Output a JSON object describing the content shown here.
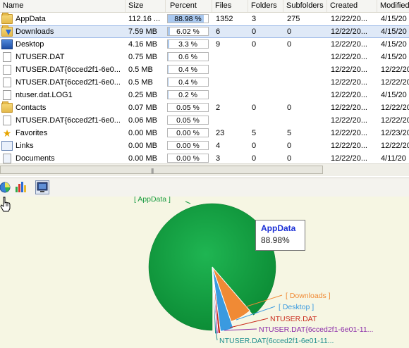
{
  "table": {
    "columns": [
      "Name",
      "Size",
      "Percent",
      "Files",
      "Folders",
      "Subfolders",
      "Created",
      "Modified"
    ],
    "rows": [
      {
        "icon": "folder-icon",
        "name": "AppData",
        "size": "112.16 ...",
        "percent": "88.98 %",
        "pct_value": 88.98,
        "files": "1352",
        "folders": "3",
        "subfolders": "275",
        "created": "12/22/20...",
        "modified": "4/15/20"
      },
      {
        "icon": "downloads-folder-icon",
        "name": "Downloads",
        "size": "7.59 MB",
        "percent": "6.02 %",
        "pct_value": 6.02,
        "files": "6",
        "folders": "0",
        "subfolders": "0",
        "created": "12/22/20...",
        "modified": "4/15/20",
        "selected": true
      },
      {
        "icon": "desktop-icon",
        "name": "Desktop",
        "size": "4.16 MB",
        "percent": "3.3 %",
        "pct_value": 3.3,
        "files": "9",
        "folders": "0",
        "subfolders": "0",
        "created": "12/22/20...",
        "modified": "4/15/20"
      },
      {
        "icon": "file-icon",
        "name": "NTUSER.DAT",
        "size": "0.75 MB",
        "percent": "0.6 %",
        "pct_value": 0.6,
        "files": "",
        "folders": "",
        "subfolders": "",
        "created": "12/22/20...",
        "modified": "4/15/20"
      },
      {
        "icon": "file-icon",
        "name": "NTUSER.DAT{6cced2f1-6e0...",
        "size": "0.5 MB",
        "percent": "0.4 %",
        "pct_value": 0.4,
        "files": "",
        "folders": "",
        "subfolders": "",
        "created": "12/22/20...",
        "modified": "12/22/20"
      },
      {
        "icon": "file-icon",
        "name": "NTUSER.DAT{6cced2f1-6e0...",
        "size": "0.5 MB",
        "percent": "0.4 %",
        "pct_value": 0.4,
        "files": "",
        "folders": "",
        "subfolders": "",
        "created": "12/22/20...",
        "modified": "12/22/20"
      },
      {
        "icon": "file-icon",
        "name": "ntuser.dat.LOG1",
        "size": "0.25 MB",
        "percent": "0.2 %",
        "pct_value": 0.2,
        "files": "",
        "folders": "",
        "subfolders": "",
        "created": "12/22/20...",
        "modified": "4/15/20"
      },
      {
        "icon": "contacts-folder-icon",
        "name": "Contacts",
        "size": "0.07 MB",
        "percent": "0.05 %",
        "pct_value": 0.05,
        "files": "2",
        "folders": "0",
        "subfolders": "0",
        "created": "12/22/20...",
        "modified": "12/22/20"
      },
      {
        "icon": "file-icon",
        "name": "NTUSER.DAT{6cced2f1-6e0...",
        "size": "0.06 MB",
        "percent": "0.05 %",
        "pct_value": 0.05,
        "files": "",
        "folders": "",
        "subfolders": "",
        "created": "12/22/20...",
        "modified": "12/22/20"
      },
      {
        "icon": "favorites-star-icon",
        "name": "Favorites",
        "size": "0.00 MB",
        "percent": "0.00 %",
        "pct_value": 0,
        "files": "23",
        "folders": "5",
        "subfolders": "5",
        "created": "12/22/20...",
        "modified": "12/23/20"
      },
      {
        "icon": "links-folder-icon",
        "name": "Links",
        "size": "0.00 MB",
        "percent": "0.00 %",
        "pct_value": 0,
        "files": "4",
        "folders": "0",
        "subfolders": "0",
        "created": "12/22/20...",
        "modified": "12/22/20"
      },
      {
        "icon": "documents-folder-icon",
        "name": "Documents",
        "size": "0.00 MB",
        "percent": "0.00 %",
        "pct_value": 0,
        "files": "3",
        "folders": "0",
        "subfolders": "0",
        "created": "12/22/20...",
        "modified": "4/11/20"
      }
    ]
  },
  "toolbar": {
    "buttons": [
      {
        "icon": "pie-chart-icon",
        "active": false
      },
      {
        "icon": "bar-chart-icon",
        "active": false
      },
      {
        "icon": "monitor-icon",
        "active": true
      }
    ]
  },
  "chart": {
    "tooltip": {
      "name": "AppData",
      "value": "88.98%"
    },
    "colors": {
      "appdata": "#0f9d3e",
      "downloads": "#f08a35",
      "desktop": "#3a9ae0",
      "ntuser": "#c92b1c",
      "ntuser2": "#8a2aa8",
      "ntuser3": "#1e8f8f"
    },
    "labels": {
      "appdata": "[ AppData ]",
      "downloads": "[ Downloads ]",
      "desktop": "[ Desktop ]",
      "ntuser": "NTUSER.DAT",
      "ntuser2": "NTUSER.DAT{6cced2f1-6e01-11...",
      "ntuser3": "NTUSER.DAT{6cced2f1-6e01-11..."
    }
  },
  "chart_data": {
    "type": "pie",
    "slices": [
      {
        "name": "AppData",
        "value": 88.98
      },
      {
        "name": "Downloads",
        "value": 6.02
      },
      {
        "name": "Desktop",
        "value": 3.3
      },
      {
        "name": "NTUSER.DAT",
        "value": 0.6
      },
      {
        "name": "NTUSER.DAT{6cced2f1-6e01-11...",
        "value": 0.4
      },
      {
        "name": "NTUSER.DAT{6cced2f1-6e01-11...",
        "value": 0.4
      }
    ]
  }
}
